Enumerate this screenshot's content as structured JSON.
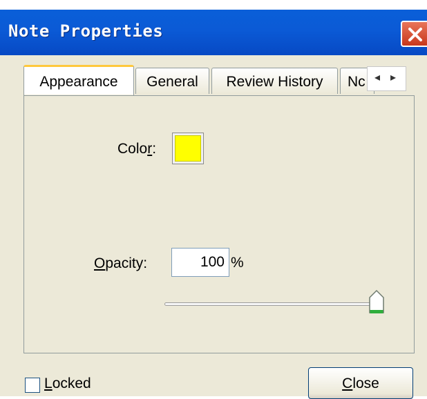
{
  "window": {
    "title": "Note Properties"
  },
  "tabs": [
    "Appearance",
    "General",
    "Review History",
    "Nc"
  ],
  "tab_scroll": {
    "left": "◂",
    "right": "▸"
  },
  "appearance": {
    "color_label_pre": "Colo",
    "color_label_accel": "r",
    "color_label_post": ":",
    "color_value": "#ffff00",
    "opacity_label_accel": "O",
    "opacity_label_rest": "pacity:",
    "opacity_value": "100",
    "opacity_unit": "%",
    "opacity_level": 100
  },
  "footer": {
    "locked_accel": "L",
    "locked_rest": "ocked",
    "locked_checked": false,
    "close_accel": "C",
    "close_rest": "lose"
  }
}
